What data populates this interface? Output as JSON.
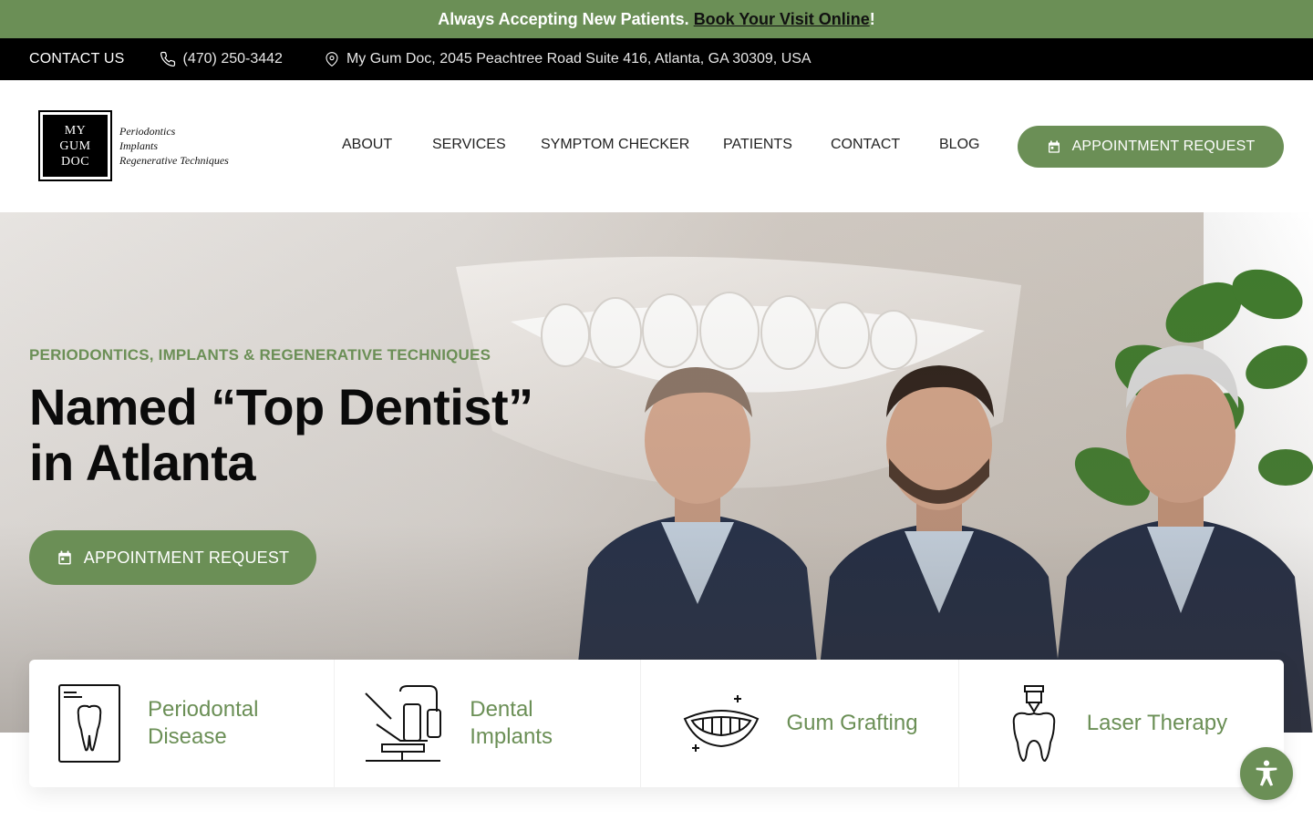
{
  "announcement": {
    "text": "Always Accepting New Patients.",
    "link": "Book Your Visit Online",
    "suffix": "!"
  },
  "topbar": {
    "contact": "CONTACT US",
    "phone": "(470) 250-3442",
    "address": "My Gum Doc, 2045 Peachtree Road Suite 416, Atlanta, GA 30309, USA"
  },
  "logo": {
    "line1": "MY",
    "line2": "GUM",
    "line3": "DOC",
    "tag1": "Periodontics",
    "tag2": "Implants",
    "tag3": "Regenerative Techniques"
  },
  "nav": {
    "items": [
      "ABOUT",
      "SERVICES",
      "SYMPTOM CHECKER",
      "PATIENTS",
      "CONTACT",
      "BLOG"
    ],
    "cta": "APPOINTMENT REQUEST"
  },
  "hero": {
    "eyebrow": "PERIODONTICS, IMPLANTS & REGENERATIVE TECHNIQUES",
    "title_line1": "Named “Top Dentist”",
    "title_line2": "in Atlanta",
    "cta": "APPOINTMENT REQUEST"
  },
  "services": [
    {
      "line1": "Periodontal",
      "line2": "Disease",
      "icon": "tooth-xray-icon"
    },
    {
      "line1": "Dental",
      "line2": "Implants",
      "icon": "dental-chair-icon"
    },
    {
      "line1": "Gum Grafting",
      "line2": "",
      "icon": "smile-icon"
    },
    {
      "line1": "Laser Therapy",
      "line2": "",
      "icon": "tooth-laser-icon"
    }
  ],
  "colors": {
    "brand_green": "#6b8f56",
    "topbar": "#000000"
  }
}
